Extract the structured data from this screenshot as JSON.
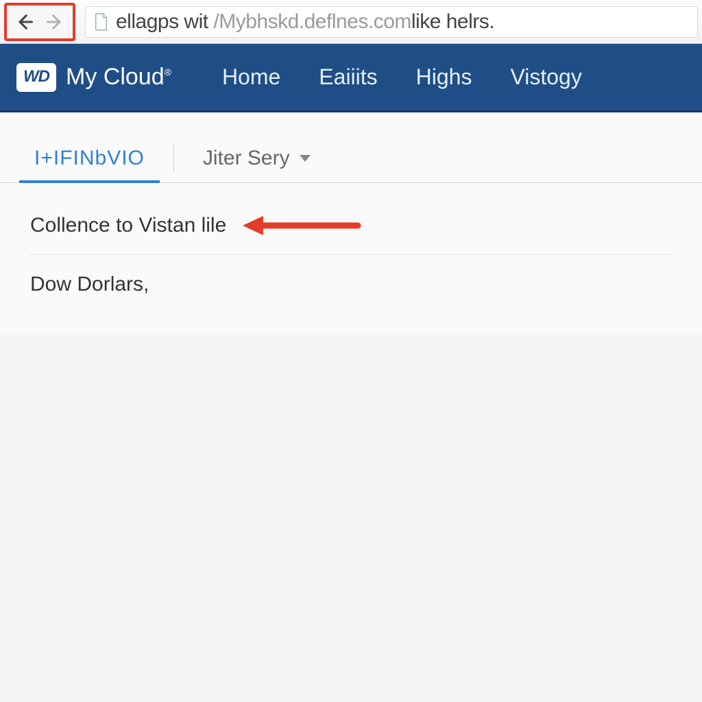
{
  "browser": {
    "address_prefix": "ellagps wit ",
    "address_mid": "/Mybhskd.deflnes.com",
    "address_suffix": "like helrs."
  },
  "header": {
    "logo_text": "WD",
    "brand_text": "My Cloud",
    "nav": [
      "Home",
      "Eaiiits",
      "Highs",
      "Vistogy"
    ]
  },
  "tabs": {
    "active": "I+IFINbVIO",
    "dropdown": "Jiter Sery"
  },
  "content": {
    "line1": "Collence to Vistan lile",
    "line2": "Dow Dorlars,"
  },
  "colors": {
    "accent": "#2f7fd6",
    "header_bg": "#1f4e87",
    "annotation": "#e43b2a"
  }
}
